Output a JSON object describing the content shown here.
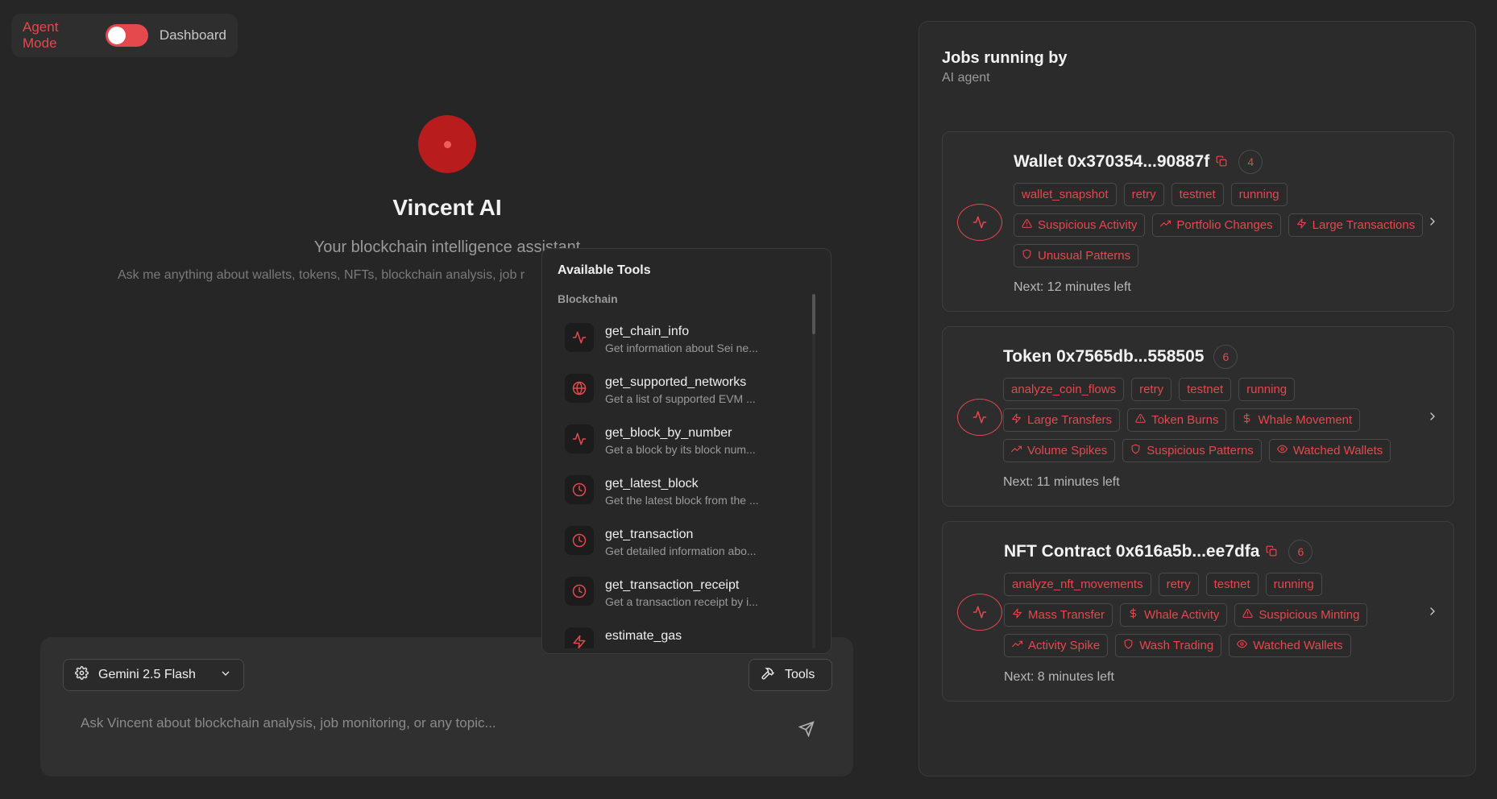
{
  "mode_switch": {
    "agent_label": "Agent Mode",
    "dashboard_label": "Dashboard",
    "active": "agent",
    "accent": "#e5484d"
  },
  "hero": {
    "title": "Vincent AI",
    "subtitle": "Your blockchain intelligence assistant",
    "hint": "Ask me anything about wallets, tokens, NFTs, blockchain analysis, job r"
  },
  "composer": {
    "model": "Gemini 2.5 Flash",
    "tools_label": "Tools",
    "placeholder": "Ask Vincent about blockchain analysis, job monitoring, or any topic..."
  },
  "tools_popup": {
    "title": "Available Tools",
    "category": "Blockchain",
    "items": [
      {
        "name": "get_chain_info",
        "desc": "Get information about Sei ne...",
        "icon": "activity-icon"
      },
      {
        "name": "get_supported_networks",
        "desc": "Get a list of supported EVM ...",
        "icon": "globe-icon"
      },
      {
        "name": "get_block_by_number",
        "desc": "Get a block by its block num...",
        "icon": "activity-icon"
      },
      {
        "name": "get_latest_block",
        "desc": "Get the latest block from the ...",
        "icon": "clock-icon"
      },
      {
        "name": "get_transaction",
        "desc": "Get detailed information abo...",
        "icon": "clock-icon"
      },
      {
        "name": "get_transaction_receipt",
        "desc": "Get a transaction receipt by i...",
        "icon": "clock-icon"
      },
      {
        "name": "estimate_gas",
        "desc": "",
        "icon": "zap-icon"
      }
    ]
  },
  "jobs": {
    "title": "Jobs running by",
    "subtitle": "AI agent",
    "cards": [
      {
        "title": "Wallet 0x370354...90887f",
        "count": "4",
        "meta_tags": [
          "wallet_snapshot",
          "retry",
          "testnet",
          "running"
        ],
        "alert_rows": [
          [
            {
              "label": "Suspicious Activity",
              "icon": "alert-triangle-icon"
            },
            {
              "label": "Portfolio Changes",
              "icon": "trending-up-icon"
            },
            {
              "label": "Large Transactions",
              "icon": "zap-icon"
            }
          ],
          [
            {
              "label": "Unusual Patterns",
              "icon": "shield-icon"
            }
          ]
        ],
        "next": "Next: 12 minutes left"
      },
      {
        "title": "Token 0x7565db...558505",
        "count": "6",
        "meta_tags": [
          "analyze_coin_flows",
          "retry",
          "testnet",
          "running"
        ],
        "alert_rows": [
          [
            {
              "label": "Large Transfers",
              "icon": "zap-icon"
            },
            {
              "label": "Token Burns",
              "icon": "alert-triangle-icon"
            },
            {
              "label": "Whale Movement",
              "icon": "dollar-icon"
            }
          ],
          [
            {
              "label": "Volume Spikes",
              "icon": "trending-up-icon"
            },
            {
              "label": "Suspicious Patterns",
              "icon": "shield-icon"
            },
            {
              "label": "Watched Wallets",
              "icon": "eye-icon"
            }
          ]
        ],
        "next": "Next: 11 minutes left"
      },
      {
        "title": "NFT Contract 0x616a5b...ee7dfa",
        "count": "6",
        "meta_tags": [
          "analyze_nft_movements",
          "retry",
          "testnet",
          "running"
        ],
        "alert_rows": [
          [
            {
              "label": "Mass Transfer",
              "icon": "zap-icon"
            },
            {
              "label": "Whale Activity",
              "icon": "dollar-icon"
            },
            {
              "label": "Suspicious Minting",
              "icon": "alert-triangle-icon"
            }
          ],
          [
            {
              "label": "Activity Spike",
              "icon": "trending-up-icon"
            },
            {
              "label": "Wash Trading",
              "icon": "shield-icon"
            },
            {
              "label": "Watched Wallets",
              "icon": "eye-icon"
            }
          ]
        ],
        "next": "Next: 8 minutes left"
      }
    ]
  }
}
